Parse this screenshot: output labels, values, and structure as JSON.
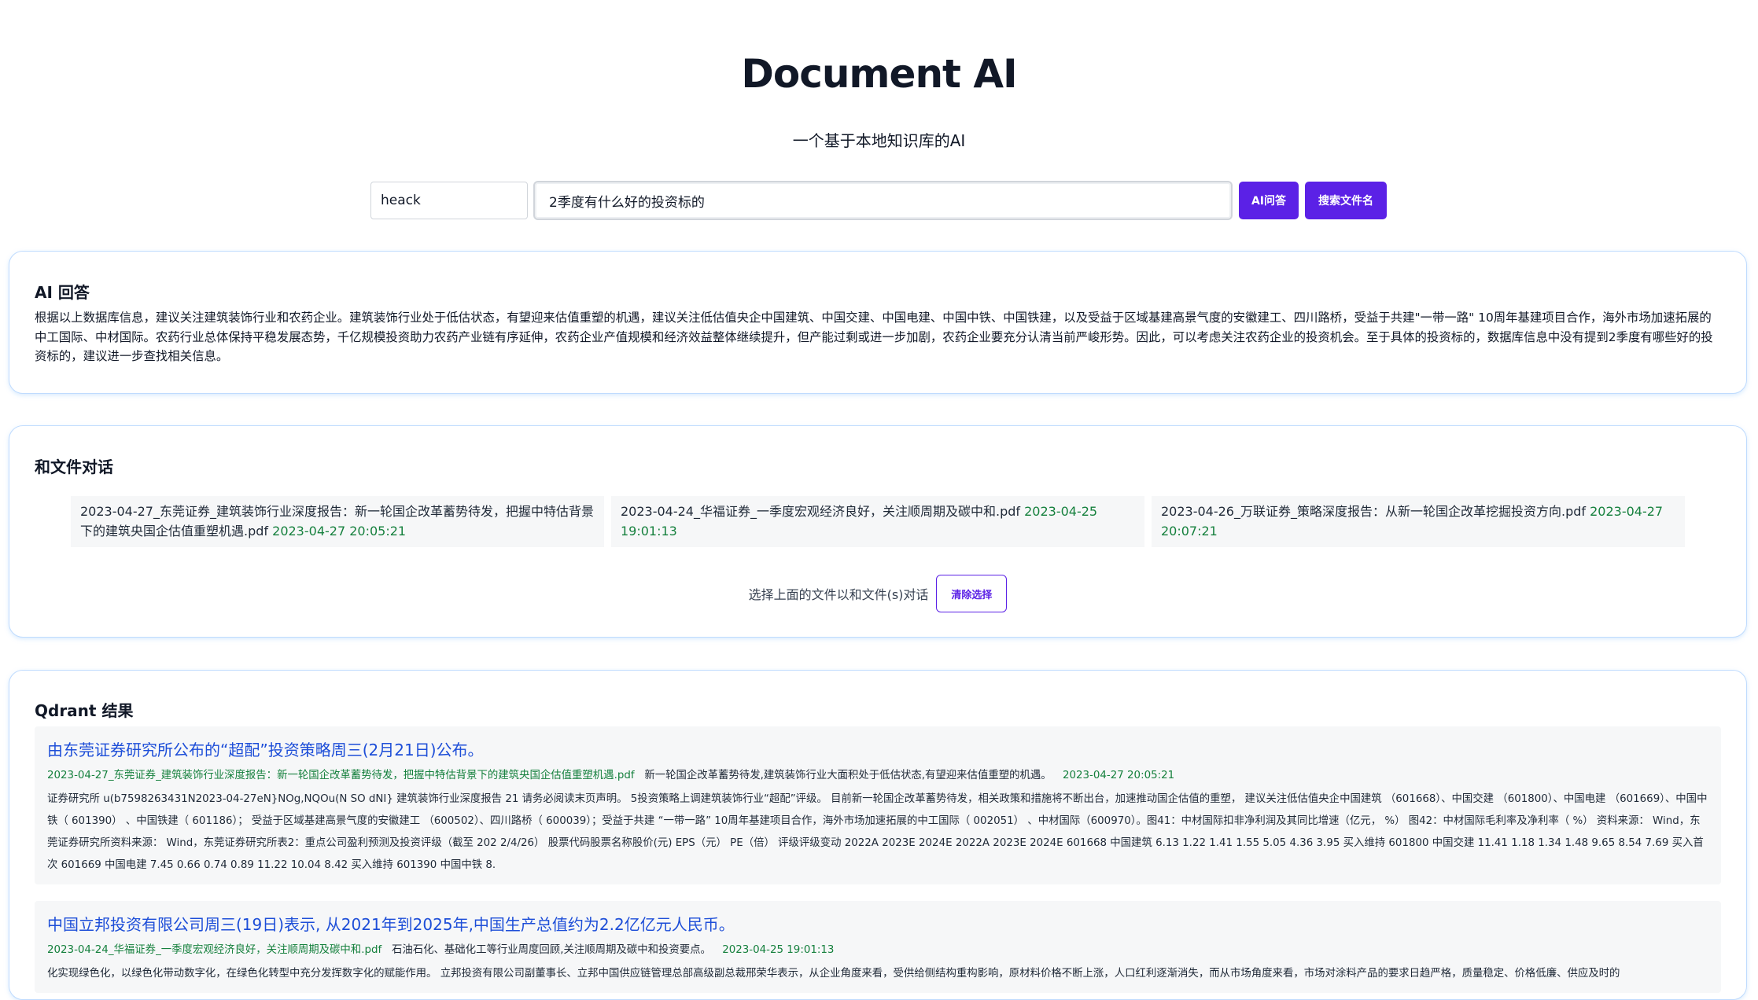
{
  "header": {
    "title": "Document AI",
    "subtitle": "一个基于本地知识库的AI"
  },
  "search": {
    "user_value": "heack",
    "query_value": "2季度有什么好的投资标的",
    "ask_label": "AI问答",
    "search_files_label": "搜索文件名"
  },
  "ai_answer": {
    "heading": "AI 回答",
    "text": "根据以上数据库信息，建议关注建筑装饰行业和农药企业。建筑装饰行业处于低估状态，有望迎来估值重塑的机遇，建议关注低估值央企中国建筑、中国交建、中国电建、中国中铁、中国铁建，以及受益于区域基建高景气度的安徽建工、四川路桥，受益于共建\"一带一路\" 10周年基建项目合作，海外市场加速拓展的中工国际、中材国际。农药行业总体保持平稳发展态势，千亿规模投资助力农药产业链有序延伸，农药企业产值规模和经济效益整体继续提升，但产能过剩或进一步加剧，农药企业要充分认清当前严峻形势。因此，可以考虑关注农药企业的投资机会。至于具体的投资标的，数据库信息中没有提到2季度有哪些好的投资标的，建议进一步查找相关信息。"
  },
  "chat": {
    "heading": "和文件对话",
    "files": [
      {
        "name": "2023-04-27_东莞证券_建筑装饰行业深度报告：新一轮国企改革蓄势待发，把握中特估背景下的建筑央国企估值重塑机遇.pdf",
        "date": "2023-04-27 20:05:21"
      },
      {
        "name": "2023-04-24_华福证券_一季度宏观经济良好，关注顺周期及碳中和.pdf",
        "date": "2023-04-25 19:01:13"
      },
      {
        "name": "2023-04-26_万联证券_策略深度报告：从新一轮国企改革挖掘投资方向.pdf",
        "date": "2023-04-27 20:07:21"
      }
    ],
    "hint": "选择上面的文件以和文件(s)对话",
    "clear_label": "清除选择"
  },
  "qdrant": {
    "heading": "Qdrant 结果",
    "results": [
      {
        "title": "由东莞证券研究所公布的“超配”投资策略周三(2月21日)公布。",
        "file": "2023-04-27_东莞证券_建筑装饰行业深度报告：新一轮国企改革蓄势待发，把握中特估背景下的建筑央国企估值重塑机遇.pdf",
        "summary": "新一轮国企改革蓄势待发,建筑装饰行业大面积处于低估状态,有望迎来估值重塑的机遇。",
        "date": "2023-04-27 20:05:21",
        "body": "证券研究所 u(b7598263431N2023-04-27eN}NOg,NQOu(N SO dNI} 建筑装饰行业深度报告 21 请务必阅读末页声明。 5投资策略上调建筑装饰行业“超配”评级。 目前新一轮国企改革蓄势待发，相关政策和措施将不断出台，加速推动国企估值的重塑， 建议关注低估值央企中国建筑 （601668）、中国交建 （601800）、中国电建 （601669）、中国中铁（ 601390） 、中国铁建（ 601186）； 受益于区域基建高景气度的安徽建工 （600502）、四川路桥（ 600039）；受益于共建 “一带一路” 10周年基建项目合作，海外市场加速拓展的中工国际（ 002051） 、中材国际（600970）。图41：中材国际扣非净利润及其同比增速（亿元， %） 图42：中材国际毛利率及净利率（ %） 资料来源： Wind，东莞证券研究所资料来源： Wind，东莞证券研究所表2：重点公司盈利预测及投资评级（截至 202 2/4/26） 股票代码股票名称股价(元) EPS（元） PE（倍） 评级评级变动 2022A 2023E 2024E 2022A 2023E 2024E 601668 中国建筑 6.13 1.22 1.41 1.55 5.05 4.36 3.95 买入维持 601800 中国交建 11.41 1.18 1.34 1.48 9.65 8.54 7.69 买入首次 601669 中国电建 7.45 0.66 0.74 0.89 11.22 10.04 8.42 买入维持 601390 中国中铁 8."
      },
      {
        "title": "中国立邦投资有限公司周三(19日)表示, 从2021年到2025年,中国生产总值约为2.2亿亿元人民币。",
        "file": "2023-04-24_华福证券_一季度宏观经济良好，关注顺周期及碳中和.pdf",
        "summary": "石油石化、基础化工等行业周度回顾,关注顺周期及碳中和投资要点。",
        "date": "2023-04-25 19:01:13",
        "body": "化实现绿色化，以绿色化带动数字化，在绿色化转型中充分发挥数字化的赋能作用。 立邦投资有限公司副董事长、立邦中国供应链管理总部高级副总裁邢荣华表示，从企业角度来看，受供给侧结构重构影响，原材料价格不断上涨，人口红利逐渐消失，而从市场角度来看，市场对涂料产品的要求日趋严格，质量稳定、价格低廉、供应及时的"
      }
    ]
  }
}
